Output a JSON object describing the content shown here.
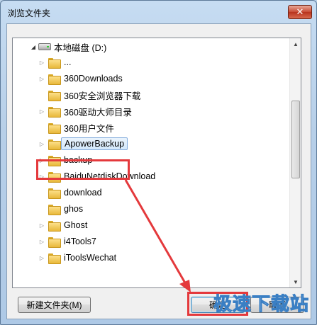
{
  "window": {
    "title": "浏览文件夹",
    "close_glyph": "✕"
  },
  "tree": {
    "root": {
      "label": "本地磁盘 (D:)",
      "icon": "drive-icon",
      "expanded": true
    },
    "items": [
      {
        "label": "...",
        "has_children": true
      },
      {
        "label": "360Downloads",
        "has_children": true
      },
      {
        "label": "360安全浏览器下载",
        "has_children": false
      },
      {
        "label": "360驱动大师目录",
        "has_children": true
      },
      {
        "label": "360用户文件",
        "has_children": false
      },
      {
        "label": "ApowerBackup",
        "has_children": true,
        "selected": true
      },
      {
        "label": "backup",
        "has_children": true
      },
      {
        "label": "BaiduNetdiskDownload",
        "has_children": true
      },
      {
        "label": "download",
        "has_children": false
      },
      {
        "label": "ghos",
        "has_children": false
      },
      {
        "label": "Ghost",
        "has_children": true
      },
      {
        "label": "i4Tools7",
        "has_children": true
      },
      {
        "label": "iToolsWechat",
        "has_children": true
      }
    ]
  },
  "buttons": {
    "new_folder": "新建文件夹(M)",
    "ok": "确定",
    "cancel": "取消"
  },
  "annotation_color": "#e4393c",
  "watermark": "极速下载站"
}
